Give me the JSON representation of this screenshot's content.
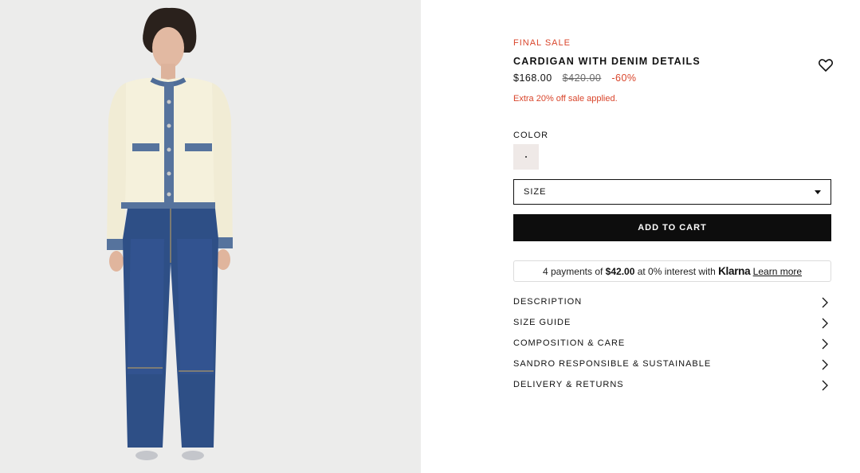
{
  "product": {
    "badge": "FINAL SALE",
    "title": "CARDIGAN WITH DENIM DETAILS",
    "price_now": "$168.00",
    "price_was": "$420.00",
    "discount": "-60%",
    "extra_offer": "Extra 20% off sale applied."
  },
  "color": {
    "label": "COLOR",
    "swatch_color": "#efe9e7"
  },
  "size": {
    "label": "SIZE"
  },
  "actions": {
    "add_to_cart": "ADD TO CART"
  },
  "klarna": {
    "prefix": "4 payments of",
    "amount": "$42.00",
    "middle": "at 0% interest with",
    "brand": "Klarna",
    "link": "Learn more"
  },
  "accordions": [
    {
      "label": "DESCRIPTION"
    },
    {
      "label": "SIZE GUIDE"
    },
    {
      "label": "COMPOSITION & CARE"
    },
    {
      "label": "SANDRO RESPONSIBLE & SUSTAINABLE"
    },
    {
      "label": "DELIVERY & RETURNS"
    }
  ],
  "icons": {
    "wishlist": "heart-icon",
    "dropdown": "caret-down-icon",
    "accordion": "chevron-right-icon"
  },
  "colors": {
    "sale_red": "#d9452b",
    "button_black": "#0d0d0d",
    "photo_bg": "#ededed"
  }
}
